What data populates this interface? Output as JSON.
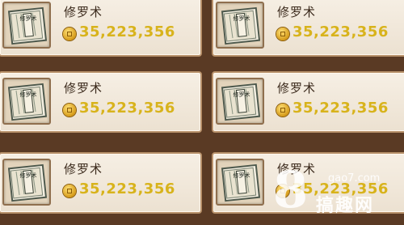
{
  "items": [
    {
      "name": "修罗术",
      "price": "35,223,356",
      "icon_glyph": "修罗术"
    },
    {
      "name": "修罗术",
      "price": "35,223,356",
      "icon_glyph": "修罗术"
    },
    {
      "name": "修罗术",
      "price": "35,223,356",
      "icon_glyph": "修罗术"
    },
    {
      "name": "修罗术",
      "price": "35,223,356",
      "icon_glyph": "修罗术"
    },
    {
      "name": "修罗术",
      "price": "35,223,356",
      "icon_glyph": "修罗术"
    },
    {
      "name": "修罗术",
      "price": "35,223,356",
      "icon_glyph": "修罗术"
    }
  ],
  "watermark": {
    "symbol": "8",
    "site": "gao7.com",
    "brand": "搞趣网"
  },
  "colors": {
    "price": "#d8b31c",
    "card_bg": "#f3ebdf",
    "card_border": "#b8916a",
    "background": "#5a3a24"
  },
  "icons": {
    "item": "scroll-book-icon",
    "currency": "gold-coin-icon"
  }
}
